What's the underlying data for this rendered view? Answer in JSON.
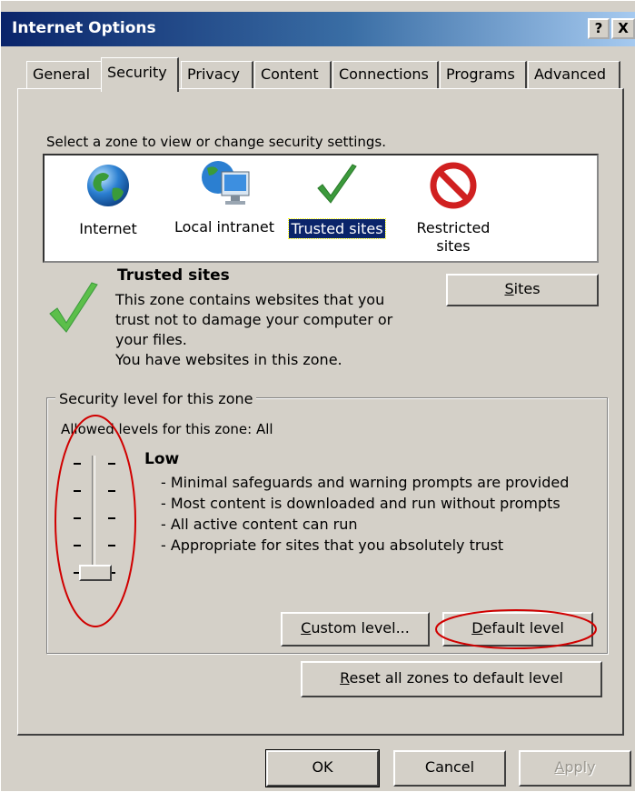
{
  "window": {
    "title": "Internet Options",
    "help_label": "?",
    "close_label": "X"
  },
  "tabs": [
    {
      "label": "General",
      "active": false
    },
    {
      "label": "Security",
      "active": true
    },
    {
      "label": "Privacy",
      "active": false
    },
    {
      "label": "Content",
      "active": false
    },
    {
      "label": "Connections",
      "active": false
    },
    {
      "label": "Programs",
      "active": false
    },
    {
      "label": "Advanced",
      "active": false
    }
  ],
  "security": {
    "zone_prompt": "Select a zone to view or change security settings.",
    "zones": [
      {
        "label": "Internet",
        "icon": "globe-icon",
        "selected": false
      },
      {
        "label": "Local intranet",
        "icon": "intranet-computer-icon",
        "selected": false
      },
      {
        "label": "Trusted sites",
        "icon": "green-checkmark-icon",
        "selected": true
      },
      {
        "label_line1": "Restricted",
        "label_line2": "sites",
        "icon": "restricted-no-icon",
        "selected": false
      }
    ],
    "selected_zone": {
      "title": "Trusted sites",
      "description_lines": [
        "This zone contains websites that you",
        "trust not to damage your computer or",
        "your files.",
        "You have websites in this zone."
      ]
    },
    "sites_button": {
      "accel": "S",
      "rest": "ites"
    },
    "level_group_title": "Security level for this zone",
    "allowed_levels": "Allowed levels for this zone: All",
    "level_name": "Low",
    "level_bullets": [
      "- Minimal safeguards and warning prompts are provided",
      "- Most content is downloaded and run without prompts",
      "- All active content can run",
      "- Appropriate for sites that you absolutely trust"
    ],
    "custom_level_button": {
      "accel": "C",
      "rest": "ustom level..."
    },
    "default_level_button": {
      "accel": "D",
      "rest": "efault level"
    },
    "reset_all_button": {
      "accel": "R",
      "rest": "eset all zones to default level"
    }
  },
  "footer": {
    "ok": "OK",
    "cancel": "Cancel",
    "apply": {
      "accel": "A",
      "rest": "pply",
      "disabled": true
    }
  },
  "colors": {
    "title_gradient_start": "#0a246a",
    "title_gradient_end": "#a6caf0",
    "dialog_face": "#d4d0c8",
    "selection": "#0a246a",
    "annotation_red": "#d00000",
    "check_green": "#3c9a3c"
  }
}
